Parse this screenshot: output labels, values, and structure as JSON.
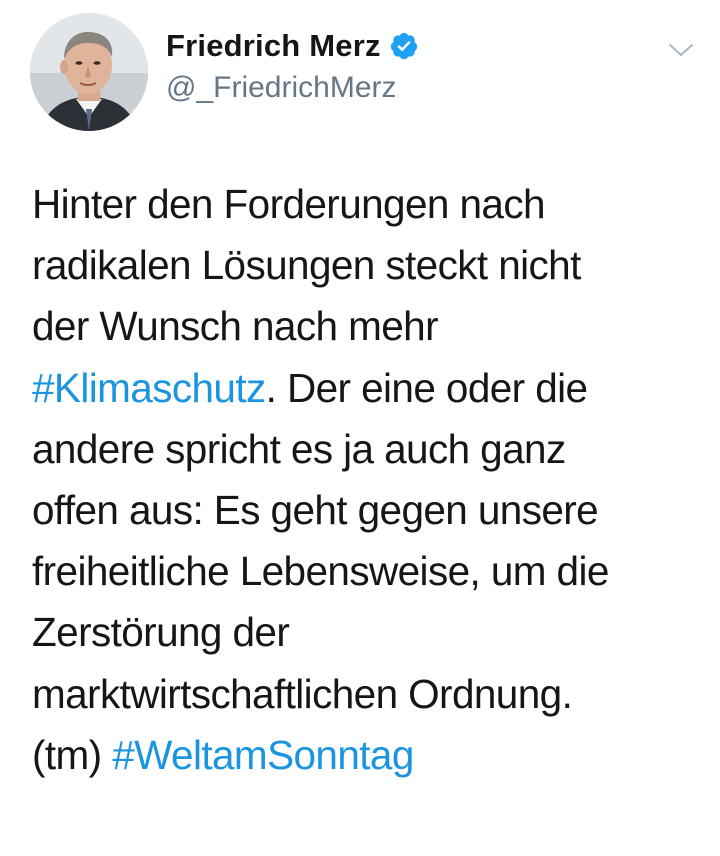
{
  "user": {
    "display_name": "Friedrich Merz",
    "handle": "@_FriedrichMerz",
    "verified": true
  },
  "icons": {
    "verified": "verified-badge-icon",
    "caret": "chevron-down-icon"
  },
  "colors": {
    "hashtag": "#1b95e0",
    "verified": "#1da1f2",
    "text": "#14171a",
    "muted": "#657786"
  },
  "tweet": {
    "line1": "Hinter den Forderungen nach",
    "line2": "radikalen Lösungen steckt nicht",
    "line3": "der Wunsch nach mehr",
    "hashtag1": "#Klimaschutz",
    "line4_rest": ". Der eine oder die",
    "line5": "andere spricht es ja auch ganz",
    "line6": "offen aus: Es geht gegen unsere",
    "line7": "freiheitliche Lebensweise, um die",
    "line8": "Zerstörung der",
    "line9": "marktwirtschaftlichen Ordnung.",
    "line10_prefix": "(tm) ",
    "hashtag2": "#WeltamSonntag"
  }
}
